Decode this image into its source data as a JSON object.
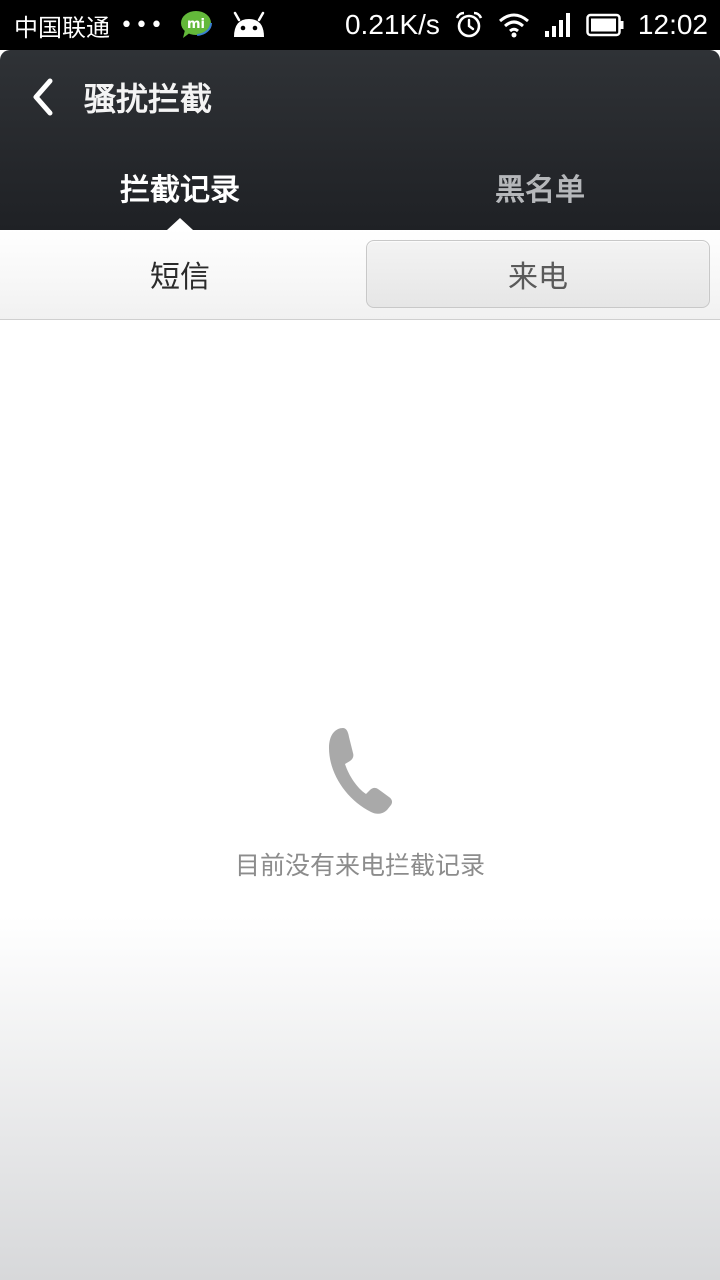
{
  "status_bar": {
    "carrier": "中国联通",
    "dots": "•••",
    "net_speed": "0.21K/s",
    "time": "12:02",
    "icons": [
      "mi-talk-icon",
      "android-icon",
      "alarm-icon",
      "wifi-icon",
      "signal-icon",
      "battery-icon"
    ]
  },
  "header": {
    "title": "骚扰拦截",
    "back_icon": "chevron-left-icon"
  },
  "tabs": [
    {
      "label": "拦截记录",
      "active": true
    },
    {
      "label": "黑名单",
      "active": false
    }
  ],
  "segments": [
    {
      "label": "短信",
      "selected": false
    },
    {
      "label": "来电",
      "selected": true
    }
  ],
  "empty_state": {
    "icon": "phone-icon",
    "message": "目前没有来电拦截记录"
  },
  "colors": {
    "header_bg": "#26282c",
    "active_tab": "#ffffff",
    "inactive_tab": "#b5b7ba",
    "empty_text": "#8c8c8c",
    "phone_icon": "#a9a9a9"
  }
}
